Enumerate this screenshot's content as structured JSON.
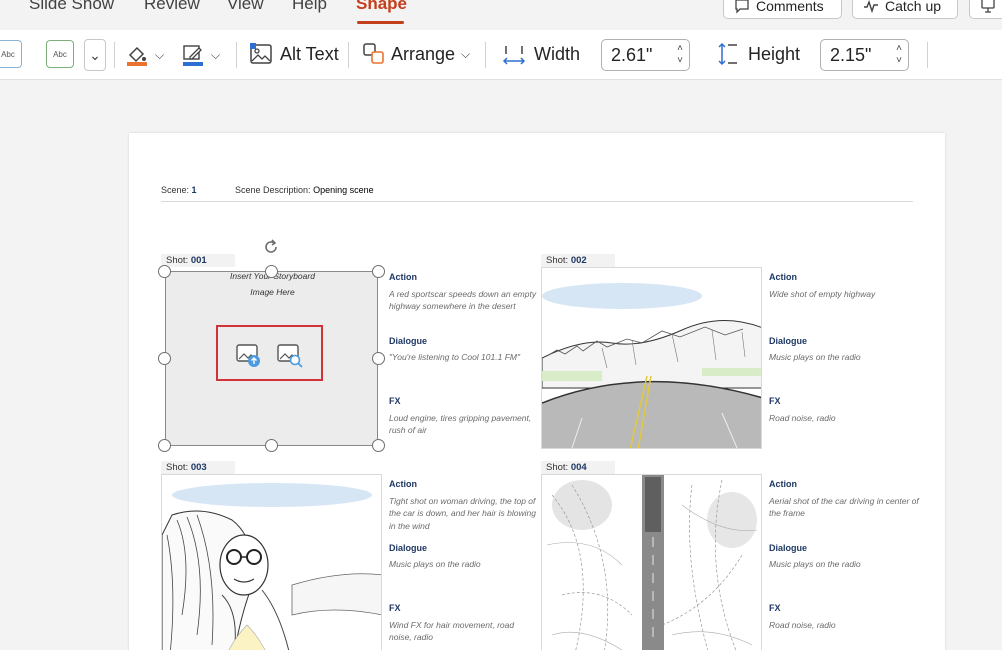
{
  "tabs": [
    {
      "label": "Slide Show",
      "active": false
    },
    {
      "label": "Review",
      "active": false
    },
    {
      "label": "View",
      "active": false
    },
    {
      "label": "Help",
      "active": false
    },
    {
      "label": "Shape",
      "active": true
    }
  ],
  "top_buttons": {
    "comments": "Comments",
    "catch_up": "Catch up"
  },
  "ribbon": {
    "style_swatches": [
      "Abc",
      "Abc"
    ],
    "alt_text": "Alt Text",
    "arrange": "Arrange",
    "width_label": "Width",
    "width_value": "2.61\"",
    "height_label": "Height",
    "height_value": "2.15\""
  },
  "slide": {
    "scene_label": "Scene:",
    "scene_value": "1",
    "scene_desc_label": "Scene Description:",
    "scene_desc_value": "Opening scene",
    "placeholder_text": "Insert Your Storyboard Image Here",
    "shots": [
      {
        "label": "Shot:",
        "number": "001",
        "action_label": "Action",
        "action": "A red sportscar speeds down an empty highway somewhere in the desert",
        "dialogue_label": "Dialogue",
        "dialogue": "\"You're listening to Cool 101.1 FM\"",
        "fx_label": "FX",
        "fx": "Loud engine, tires gripping pavement, rush of air"
      },
      {
        "label": "Shot:",
        "number": "002",
        "action_label": "Action",
        "action": "Wide shot of empty highway",
        "dialogue_label": "Dialogue",
        "dialogue": "Music plays on the radio",
        "fx_label": "FX",
        "fx": "Road noise, radio"
      },
      {
        "label": "Shot:",
        "number": "003",
        "action_label": "Action",
        "action": "Tight shot on woman driving, the top of the car is down, and her hair is blowing in the wind",
        "dialogue_label": "Dialogue",
        "dialogue": "Music plays on the radio",
        "fx_label": "FX",
        "fx": "Wind FX for hair movement, road noise, radio"
      },
      {
        "label": "Shot:",
        "number": "004",
        "action_label": "Action",
        "action": "Aerial shot of the car driving in center of the frame",
        "dialogue_label": "Dialogue",
        "dialogue": "Music plays on the radio",
        "fx_label": "FX",
        "fx": "Road noise, radio"
      }
    ]
  },
  "colors": {
    "accent": "#c43e1c",
    "shot_number": "#1f3864",
    "highlight_box": "#d13438"
  }
}
